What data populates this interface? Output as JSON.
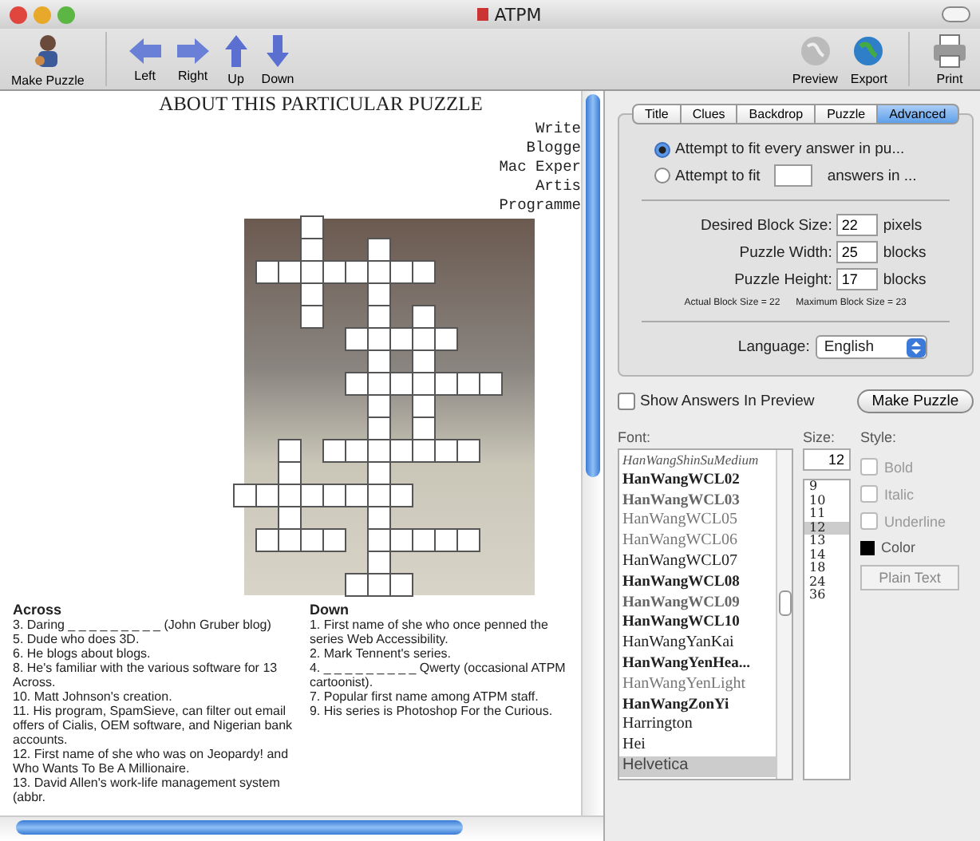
{
  "window": {
    "title": "ATPM"
  },
  "toolbar": {
    "left": [
      {
        "label": "Make Puzzle",
        "kind": "puzzle"
      },
      {
        "label": "Left",
        "kind": "left"
      },
      {
        "label": "Right",
        "kind": "right"
      },
      {
        "label": "Up",
        "kind": "up"
      },
      {
        "label": "Down",
        "kind": "down"
      }
    ],
    "right": [
      {
        "label": "Preview",
        "kind": "preview"
      },
      {
        "label": "Export",
        "kind": "export"
      },
      {
        "label": "Print",
        "kind": "print"
      }
    ]
  },
  "document": {
    "heading": "ABOUT THIS PARTICULAR PUZZLE",
    "credits": [
      "Write",
      "Blogge",
      "Mac Exper",
      "Artis",
      "Programme"
    ],
    "across": {
      "title": "Across",
      "clues": [
        "3. Daring _ _ _ _ _ _ _ _ _ (John Gruber blog)",
        "5. Dude who does 3D.",
        "6. He blogs about blogs.",
        "8. He's familiar with the various software for 13 Across.",
        "10. Matt Johnson's creation.",
        "11. His program, SpamSieve, can filter out email offers of Cialis, OEM software, and Nigerian bank accounts.",
        "12. First name of she who was on Jeopardy! and Who Wants To Be A Millionaire.",
        "13. David Allen's work-life management system (abbr."
      ]
    },
    "down": {
      "title": "Down",
      "clues": [
        "1. First name of she who once penned the series Web Accessibility.",
        "2. Mark Tennent's series.",
        "4. _ _ _ _ _ _ _ _ _ Qwerty (occasional ATPM cartoonist).",
        "7. Popular first name among ATPM staff.",
        "9. His series is Photoshop For the Curious."
      ]
    }
  },
  "settings": {
    "tabs": [
      {
        "label": "Title",
        "selected": false
      },
      {
        "label": "Clues",
        "selected": false
      },
      {
        "label": "Backdrop",
        "selected": false
      },
      {
        "label": "Puzzle",
        "selected": false
      },
      {
        "label": "Advanced",
        "selected": true
      }
    ],
    "fit_options": [
      {
        "kind": "plain",
        "label": "Attempt to fit every answer in pu...",
        "selected": true
      },
      {
        "kind": "count",
        "label": "Attempt to fit",
        "suffix": "answers in ...",
        "selected": false
      }
    ],
    "fields": [
      {
        "label": "Desired Block Size:",
        "value": "22",
        "unit": "pixels"
      },
      {
        "label": "Puzzle Width:",
        "value": "25",
        "unit": "blocks"
      },
      {
        "label": "Puzzle Height:",
        "value": "17",
        "unit": "blocks"
      }
    ],
    "block_info": [
      "Actual Block Size = 22",
      "Maximum Block Size = 23"
    ],
    "language": {
      "label": "Language:",
      "value": "English"
    }
  },
  "show_answers": {
    "label": "Show Answers In Preview",
    "checked": false
  },
  "make_puzzle_button": "Make Puzzle",
  "font_panel": {
    "font_label": "Font:",
    "fonts": [
      {
        "name": "HanWangShinSuMedium",
        "kind": "italic",
        "selected": false
      },
      {
        "name": "HanWangWCL02",
        "kind": "bold",
        "selected": false
      },
      {
        "name": "HanWangWCL03",
        "kind": "outline",
        "selected": false
      },
      {
        "name": "HanWangWCL05",
        "kind": "light",
        "selected": false
      },
      {
        "name": "HanWangWCL06",
        "kind": "light",
        "selected": false
      },
      {
        "name": "HanWangWCL07",
        "kind": "regular",
        "selected": false
      },
      {
        "name": "HanWangWCL08",
        "kind": "bold",
        "selected": false
      },
      {
        "name": "HanWangWCL09",
        "kind": "outline",
        "selected": false
      },
      {
        "name": "HanWangWCL10",
        "kind": "bold",
        "selected": false
      },
      {
        "name": "HanWangYanKai",
        "kind": "regular",
        "selected": false
      },
      {
        "name": "HanWangYenHea...",
        "kind": "bold",
        "selected": false
      },
      {
        "name": "HanWangYenLight",
        "kind": "light",
        "selected": false
      },
      {
        "name": "HanWangZonYi",
        "kind": "bold",
        "selected": false
      },
      {
        "name": "Harrington",
        "kind": "regular",
        "selected": false
      },
      {
        "name": "Hei",
        "kind": "regular",
        "selected": false
      },
      {
        "name": "Helvetica",
        "kind": "regular",
        "selected": true
      }
    ],
    "size_label": "Size:",
    "size_value": "12",
    "sizes": [
      {
        "value": "9",
        "selected": false
      },
      {
        "value": "10",
        "selected": false
      },
      {
        "value": "11",
        "selected": false
      },
      {
        "value": "12",
        "selected": true
      },
      {
        "value": "13",
        "selected": false
      },
      {
        "value": "14",
        "selected": false
      },
      {
        "value": "18",
        "selected": false
      },
      {
        "value": "24",
        "selected": false
      },
      {
        "value": "36",
        "selected": false
      }
    ],
    "style_label": "Style:",
    "styles": [
      {
        "label": "Bold",
        "checked": false,
        "disabled": true
      },
      {
        "label": "Italic",
        "checked": false,
        "disabled": true
      },
      {
        "label": "Underline",
        "checked": false,
        "disabled": true
      }
    ],
    "color_label": "Color",
    "plain_text_button": "Plain Text"
  }
}
